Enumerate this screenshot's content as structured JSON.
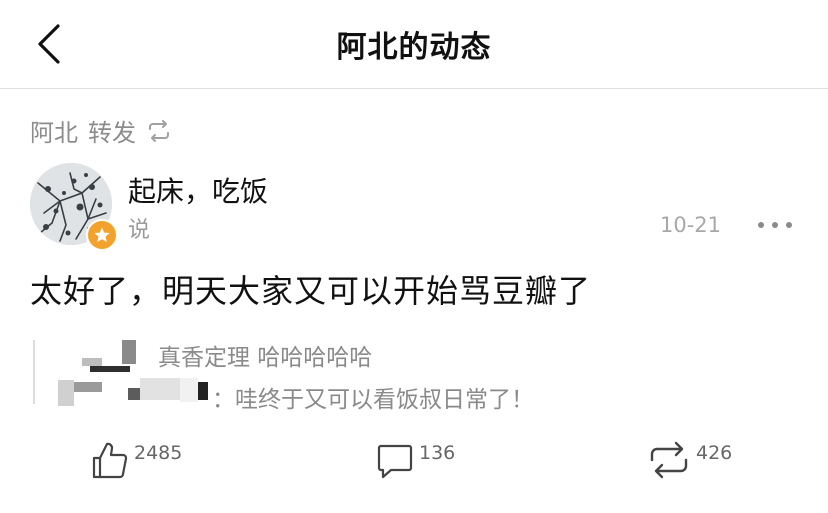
{
  "header": {
    "title": "阿北的动态",
    "back_icon": "chevron-left-icon"
  },
  "repost": {
    "user": "阿北",
    "label": "转发",
    "icon": "repost-icon"
  },
  "post": {
    "author": "起床，吃饭",
    "subtext": "说",
    "date": "10-21",
    "text": "太好了，明天大家又可以开始骂豆瓣了",
    "badge_color": "#f3a32d"
  },
  "quote": {
    "line1": "真香定理 哈哈哈哈哈",
    "line2": "：哇终于又可以看饭叔日常了！"
  },
  "actions": {
    "like_count": "2485",
    "comment_count": "136",
    "repost_count": "426"
  }
}
